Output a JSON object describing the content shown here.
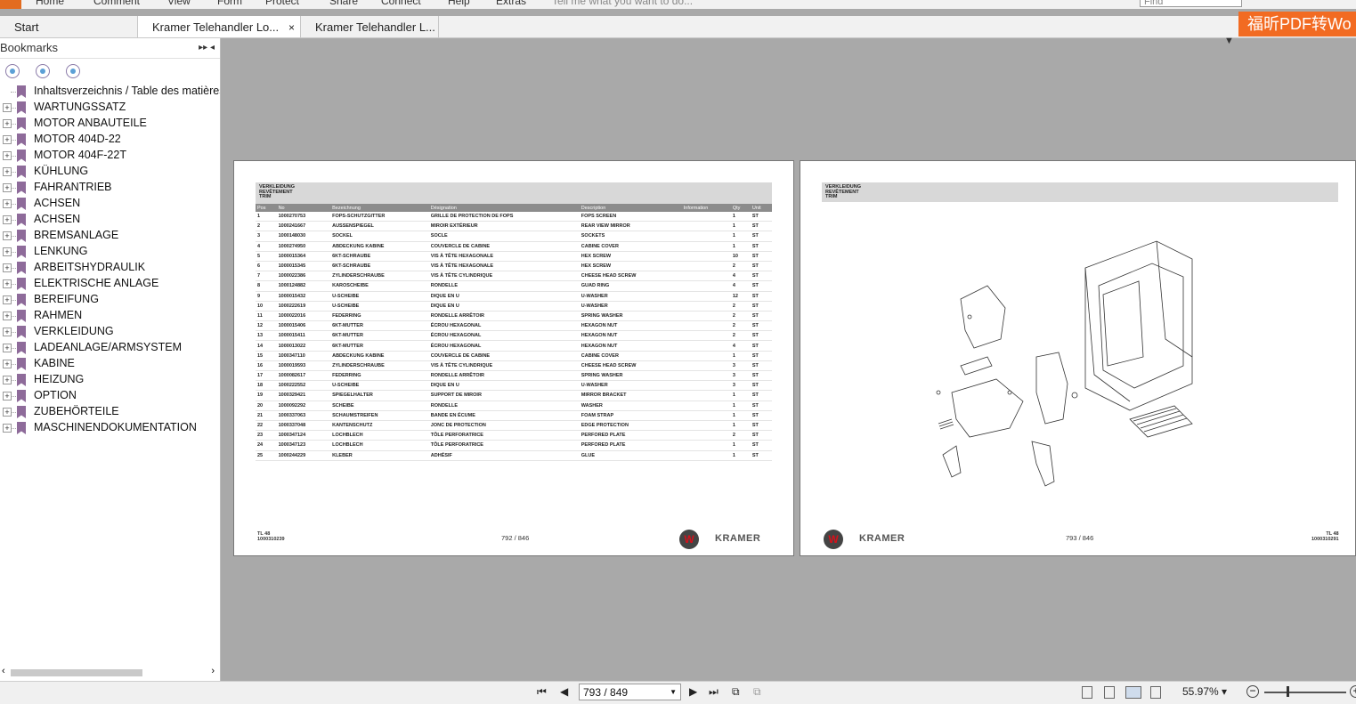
{
  "ribbon": {
    "menu": [
      "Home",
      "Comment",
      "View",
      "Form",
      "Protect",
      "Share",
      "Connect",
      "Help",
      "Extras"
    ],
    "tell_me": "Tell me what you want to do...",
    "find_placeholder": "Find"
  },
  "tabs": [
    {
      "label": "Start"
    },
    {
      "label": "Kramer Telehandler Lo...",
      "close": "×"
    },
    {
      "label": "Kramer Telehandler L..."
    }
  ],
  "promo": "福昕PDF转Wo",
  "sidebar": {
    "title": "Bookmarks",
    "controls": "▸▸ ◂",
    "bookmarks": [
      "Inhaltsverzeichnis / Table des matières",
      "WARTUNGSSATZ",
      "MOTOR ANBAUTEILE",
      "MOTOR 404D-22",
      "MOTOR 404F-22T",
      "KÜHLUNG",
      "FAHRANTRIEB",
      "ACHSEN",
      "ACHSEN",
      "BREMSANLAGE",
      "LENKUNG",
      "ARBEITSHYDRAULIK",
      "ELEKTRISCHE ANLAGE",
      "BEREIFUNG",
      "RAHMEN",
      "VERKLEIDUNG",
      "LADEANLAGE/ARMSYSTEM",
      "KABINE",
      "HEIZUNG",
      "OPTION",
      "ZUBEHÖRTEILE",
      "MASCHINENDOKUMENTATION"
    ]
  },
  "page1": {
    "header": [
      "VERKLEIDUNG",
      "REVÊTEMENT",
      "TRIM"
    ],
    "columns": [
      "Pos",
      "No",
      "Bezeichnung",
      "Désignation",
      "Description",
      "Information",
      "Qty",
      "Unit"
    ],
    "rows": [
      [
        "1",
        "1000270753",
        "FOPS-SCHUTZGITTER",
        "GRILLE DE PROTECTION DE FOPS",
        "FOPS SCREEN",
        "",
        "1",
        "ST"
      ],
      [
        "2",
        "1000241667",
        "AUSSENSPIEGEL",
        "MIROIR EXTÉRIEUR",
        "REAR VIEW MIRROR",
        "",
        "1",
        "ST"
      ],
      [
        "3",
        "1000148030",
        "SOCKEL",
        "SOCLE",
        "SOCKETS",
        "",
        "1",
        "ST"
      ],
      [
        "4",
        "1000274950",
        "ABDECKUNG KABINE",
        "COUVERCLE DE CABINE",
        "CABINE COVER",
        "",
        "1",
        "ST"
      ],
      [
        "5",
        "1000015364",
        "6KT-SCHRAUBE",
        "VIS À TÊTE HEXAGONALE",
        "HEX SCREW",
        "",
        "10",
        "ST"
      ],
      [
        "6",
        "1000015345",
        "6KT-SCHRAUBE",
        "VIS À TÊTE HEXAGONALE",
        "HEX SCREW",
        "",
        "2",
        "ST"
      ],
      [
        "7",
        "1000022386",
        "ZYLINDERSCHRAUBE",
        "VIS À TÊTE CYLINDRIQUE",
        "CHEESE HEAD SCREW",
        "",
        "4",
        "ST"
      ],
      [
        "8",
        "1000124882",
        "KAROSCHEIBE",
        "RONDELLE",
        "GUAD RING",
        "",
        "4",
        "ST"
      ],
      [
        "9",
        "1000015432",
        "U-SCHEIBE",
        "DIQUE EN U",
        "U-WASHER",
        "",
        "12",
        "ST"
      ],
      [
        "10",
        "1000222619",
        "U-SCHEIBE",
        "DIQUE EN U",
        "U-WASHER",
        "",
        "2",
        "ST"
      ],
      [
        "11",
        "1000022016",
        "FEDERRING",
        "RONDELLE ARRÊTOIR",
        "SPRING WASHER",
        "",
        "2",
        "ST"
      ],
      [
        "12",
        "1000015406",
        "6KT-MUTTER",
        "ÉCROU HEXAGONAL",
        "HEXAGON NUT",
        "",
        "2",
        "ST"
      ],
      [
        "13",
        "1000015411",
        "6KT-MUTTER",
        "ÉCROU HEXAGONAL",
        "HEXAGON NUT",
        "",
        "2",
        "ST"
      ],
      [
        "14",
        "1000013022",
        "6KT-MUTTER",
        "ÉCROU HEXAGONAL",
        "HEXAGON NUT",
        "",
        "4",
        "ST"
      ],
      [
        "15",
        "1000347110",
        "ABDECKUNG KABINE",
        "COUVERCLE DE CABINE",
        "CABINE COVER",
        "",
        "1",
        "ST"
      ],
      [
        "16",
        "1000019593",
        "ZYLINDERSCHRAUBE",
        "VIS À TÊTE CYLINDRIQUE",
        "CHEESE HEAD SCREW",
        "",
        "3",
        "ST"
      ],
      [
        "17",
        "1000082617",
        "FEDERRING",
        "RONDELLE ARRÊTOIR",
        "SPRING WASHER",
        "",
        "3",
        "ST"
      ],
      [
        "18",
        "1000222552",
        "U-SCHEIBE",
        "DIQUE EN U",
        "U-WASHER",
        "",
        "3",
        "ST"
      ],
      [
        "19",
        "1000329421",
        "SPIEGELHALTER",
        "SUPPORT DE MIROIR",
        "MIRROR BRACKET",
        "",
        "1",
        "ST"
      ],
      [
        "20",
        "1000092292",
        "SCHEIBE",
        "RONDELLE",
        "WASHER",
        "",
        "1",
        "ST"
      ],
      [
        "21",
        "1000337063",
        "SCHAUMSTREIFEN",
        "BANDE EN ÉCUME",
        "FOAM STRAP",
        "",
        "1",
        "ST"
      ],
      [
        "22",
        "1000337048",
        "KANTENSCHUTZ",
        "JONC DE PROTECTION",
        "EDGE PROTECTION",
        "",
        "1",
        "ST"
      ],
      [
        "23",
        "1000347124",
        "LOCHBLECH",
        "TÔLE PERFORATRICE",
        "PERFORED PLATE",
        "",
        "2",
        "ST"
      ],
      [
        "24",
        "1000347123",
        "LOCHBLECH",
        "TÔLE PERFORATRICE",
        "PERFORED PLATE",
        "",
        "1",
        "ST"
      ],
      [
        "25",
        "1000244229",
        "KLEBER",
        "ADHÉSIF",
        "GLUE",
        "",
        "1",
        "ST"
      ]
    ],
    "footer_model": "TL 48",
    "footer_id": "1000310239",
    "page_num": "792 / 846",
    "brand": "KRAMER"
  },
  "page2": {
    "header": [
      "VERKLEIDUNG",
      "REVÊTEMENT",
      "TRIM"
    ],
    "brand": "KRAMER",
    "page_num": "793 / 846",
    "footer_model": "TL 48",
    "footer_id": "1000310291"
  },
  "bottombar": {
    "page_input": "793 / 849",
    "zoom": "55.97%"
  }
}
